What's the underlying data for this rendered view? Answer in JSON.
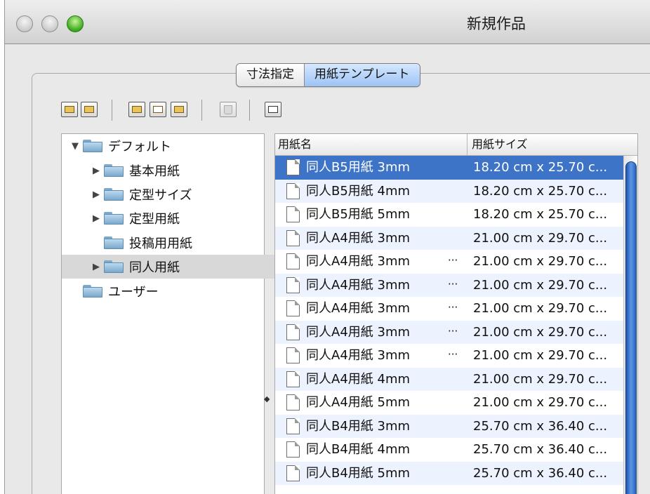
{
  "window": {
    "title": "新規作品"
  },
  "tabs": [
    {
      "label": "寸法指定",
      "selected": false
    },
    {
      "label": "用紙テンプレート",
      "selected": true
    }
  ],
  "toolbar": {
    "icons": [
      "folder-up-icon",
      "folder-down-icon",
      "open-folder-icon",
      "new-item-icon",
      "new-folder-icon",
      "trash-icon",
      "panel-icon"
    ]
  },
  "tree": {
    "items": [
      {
        "label": "デフォルト",
        "expanded": true
      },
      {
        "label": "基本用紙",
        "expanded": false
      },
      {
        "label": "定型サイズ",
        "expanded": false
      },
      {
        "label": "定型用紙",
        "expanded": false
      },
      {
        "label": "投稿用用紙"
      },
      {
        "label": "同人用紙",
        "expanded": false,
        "selected": true
      },
      {
        "label": "ユーザー"
      }
    ]
  },
  "table": {
    "columns": [
      "用紙名",
      "用紙サイズ"
    ],
    "rows": [
      {
        "name": "同人B5用紙 3mm",
        "dots": "",
        "size": "18.20 cm x 25.70 c..."
      },
      {
        "name": "同人B5用紙 4mm",
        "dots": "",
        "size": "18.20 cm x 25.70 c..."
      },
      {
        "name": "同人B5用紙 5mm",
        "dots": "",
        "size": "18.20 cm x 25.70 c..."
      },
      {
        "name": "同人A4用紙 3mm",
        "dots": "",
        "size": "21.00 cm x 29.70 c..."
      },
      {
        "name": "同人A4用紙 3mm",
        "dots": "···",
        "size": "21.00 cm x 29.70 c..."
      },
      {
        "name": "同人A4用紙 3mm",
        "dots": "···",
        "size": "21.00 cm x 29.70 c..."
      },
      {
        "name": "同人A4用紙 3mm",
        "dots": "···",
        "size": "21.00 cm x 29.70 c..."
      },
      {
        "name": "同人A4用紙 3mm",
        "dots": "···",
        "size": "21.00 cm x 29.70 c..."
      },
      {
        "name": "同人A4用紙 3mm",
        "dots": "···",
        "size": "21.00 cm x 29.70 c..."
      },
      {
        "name": "同人A4用紙 4mm",
        "dots": "",
        "size": "21.00 cm x 29.70 c..."
      },
      {
        "name": "同人A4用紙 5mm",
        "dots": "",
        "size": "21.00 cm x 29.70 c..."
      },
      {
        "name": "同人B4用紙 3mm",
        "dots": "",
        "size": "25.70 cm x 36.40 c..."
      },
      {
        "name": "同人B4用紙 4mm",
        "dots": "",
        "size": "25.70 cm x 36.40 c..."
      },
      {
        "name": "同人B4用紙 5mm",
        "dots": "",
        "size": "25.70 cm x 36.40 c..."
      }
    ]
  }
}
